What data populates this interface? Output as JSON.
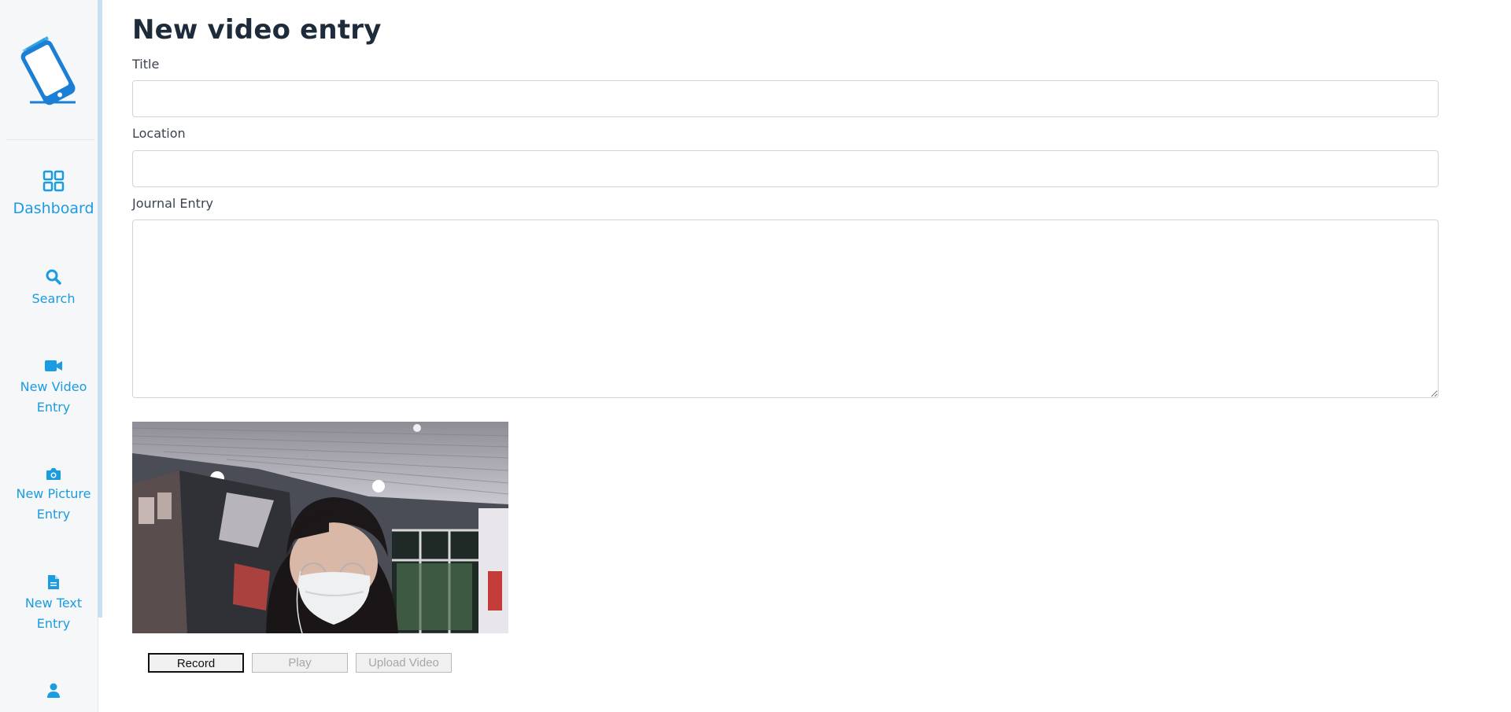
{
  "sidebar": {
    "logo": "tablet-book-logo",
    "items": [
      {
        "label": "Dashboard",
        "icon": "grid-icon"
      },
      {
        "label": "Search",
        "icon": "search-icon"
      },
      {
        "label": "New Video Entry",
        "icon": "video-camera-icon"
      },
      {
        "label": "New Picture Entry",
        "icon": "camera-icon"
      },
      {
        "label": "New Text Entry",
        "icon": "file-icon"
      },
      {
        "label": "",
        "icon": "user-icon"
      }
    ]
  },
  "main": {
    "page_title": "New video entry",
    "title_label": "Title",
    "title_value": "",
    "location_label": "Location",
    "location_value": "",
    "journal_label": "Journal Entry",
    "journal_value": ""
  },
  "video": {
    "record_label": "Record",
    "play_label": "Play",
    "upload_label": "Upload Video"
  },
  "colors": {
    "accent": "#1b9be0",
    "title": "#1d2b3b",
    "sidebar_bg": "#f6f7f9"
  }
}
